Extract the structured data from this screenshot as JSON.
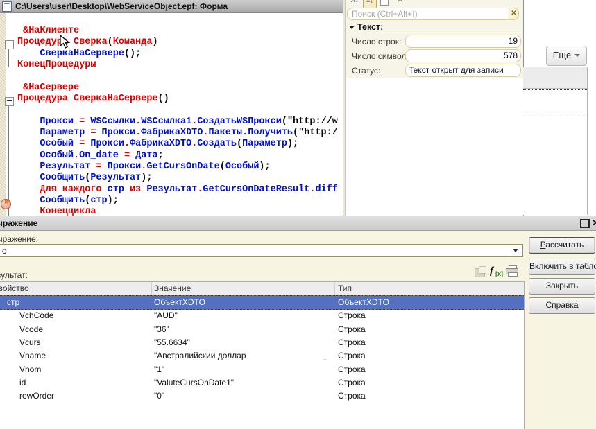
{
  "colors": {
    "keyword": "#de0000",
    "identifier": "#0010cf",
    "selection_bg": "#5470c2",
    "palette_bg": "#f7f4e8",
    "dialog_bg": "#f8f4e2"
  },
  "editor": {
    "title": "C:\\Users\\user\\Desktop\\WebServiceObject.epf: Форма",
    "code_lines": [
      [
        [
          " &НаКлиенте",
          "k"
        ]
      ],
      [
        [
          "Процедура ",
          "k"
        ],
        [
          "Сверка",
          "k"
        ],
        [
          "(",
          "d"
        ],
        [
          "Команда",
          "k"
        ],
        [
          ")",
          "d"
        ]
      ],
      [
        [
          "    ",
          "d"
        ],
        [
          "СверкаНаСервере",
          "i"
        ],
        [
          "();",
          "d"
        ]
      ],
      [
        [
          "КонецПроцедуры",
          "k"
        ]
      ],
      [],
      [
        [
          " &НаСервере",
          "k"
        ]
      ],
      [
        [
          "Процедура ",
          "k"
        ],
        [
          "СверкаНаСервере",
          "k"
        ],
        [
          "()",
          "d"
        ]
      ],
      [],
      [
        [
          "    ",
          "d"
        ],
        [
          "Прокси",
          "i"
        ],
        [
          " ",
          "d"
        ],
        [
          "=",
          "o"
        ],
        [
          " ",
          "d"
        ],
        [
          "WSСсылки",
          "i"
        ],
        [
          ".",
          "o"
        ],
        [
          "WSСсылка1",
          "i"
        ],
        [
          ".",
          "o"
        ],
        [
          "СоздатьWSПрокси",
          "i"
        ],
        [
          "(",
          "d"
        ],
        [
          "\"http://w",
          "s"
        ]
      ],
      [
        [
          "    ",
          "d"
        ],
        [
          "Параметр",
          "i"
        ],
        [
          " ",
          "d"
        ],
        [
          "=",
          "o"
        ],
        [
          " ",
          "d"
        ],
        [
          "Прокси",
          "i"
        ],
        [
          ".",
          "o"
        ],
        [
          "ФабрикаXDTO",
          "i"
        ],
        [
          ".",
          "o"
        ],
        [
          "Пакеты",
          "i"
        ],
        [
          ".",
          "o"
        ],
        [
          "Получить",
          "i"
        ],
        [
          "(",
          "d"
        ],
        [
          "\"http:/",
          "s"
        ]
      ],
      [
        [
          "    ",
          "d"
        ],
        [
          "Особый",
          "i"
        ],
        [
          " ",
          "d"
        ],
        [
          "=",
          "o"
        ],
        [
          " ",
          "d"
        ],
        [
          "Прокси",
          "i"
        ],
        [
          ".",
          "o"
        ],
        [
          "ФабрикаXDTO",
          "i"
        ],
        [
          ".",
          "o"
        ],
        [
          "Создать",
          "i"
        ],
        [
          "(",
          "d"
        ],
        [
          "Параметр",
          "i"
        ],
        [
          ");",
          "d"
        ]
      ],
      [
        [
          "    ",
          "d"
        ],
        [
          "Особый",
          "i"
        ],
        [
          ".",
          "o"
        ],
        [
          "On_date",
          "i"
        ],
        [
          " ",
          "d"
        ],
        [
          "=",
          "o"
        ],
        [
          " ",
          "d"
        ],
        [
          "Дата",
          "i"
        ],
        [
          ";",
          "d"
        ]
      ],
      [
        [
          "    ",
          "d"
        ],
        [
          "Результат",
          "i"
        ],
        [
          " ",
          "d"
        ],
        [
          "=",
          "o"
        ],
        [
          " ",
          "d"
        ],
        [
          "Прокси",
          "i"
        ],
        [
          ".",
          "o"
        ],
        [
          "GetCursOnDate",
          "i"
        ],
        [
          "(",
          "d"
        ],
        [
          "Особый",
          "i"
        ],
        [
          ");",
          "d"
        ]
      ],
      [
        [
          "    ",
          "d"
        ],
        [
          "Сообщить",
          "i"
        ],
        [
          "(",
          "d"
        ],
        [
          "Результат",
          "i"
        ],
        [
          ");",
          "d"
        ]
      ],
      [
        [
          "    ",
          "d"
        ],
        [
          "Для",
          "k"
        ],
        [
          " ",
          "d"
        ],
        [
          "каждого",
          "k"
        ],
        [
          " ",
          "d"
        ],
        [
          "стр",
          "i"
        ],
        [
          " ",
          "d"
        ],
        [
          "из",
          "k"
        ],
        [
          " ",
          "d"
        ],
        [
          "Результат",
          "i"
        ],
        [
          ".",
          "o"
        ],
        [
          "GetCursOnDateResult",
          "i"
        ],
        [
          ".",
          "o"
        ],
        [
          "diff",
          "i"
        ]
      ],
      [
        [
          "    ",
          "d"
        ],
        [
          "Сообщить",
          "i"
        ],
        [
          "(",
          "d"
        ],
        [
          "стр",
          "i"
        ],
        [
          ");",
          "d"
        ]
      ],
      [
        [
          "    ",
          "d"
        ],
        [
          "Конеццикла",
          "k"
        ]
      ]
    ]
  },
  "palette": {
    "search_placeholder": "Поиск (Ctrl+Alt+I)",
    "clear_glyph": "✕",
    "section_title": "Текст:",
    "fields": [
      {
        "label": "Число строк:",
        "value": "19"
      },
      {
        "label": "Число символов:",
        "value": "578"
      },
      {
        "label": "Статус:",
        "value": "Текст открыт для записи"
      }
    ]
  },
  "form": {
    "more_button": "Еще"
  },
  "dialog": {
    "title": "Выражение",
    "expression_label": "Выражение:",
    "expression_value": "о",
    "result_label": "Результат:",
    "truncation_mark": "_",
    "buttons": [
      {
        "name": "calculate-button",
        "pre": "",
        "key": "Р",
        "post": "ассчитать",
        "default": true
      },
      {
        "name": "include-in-watch-button",
        "pre": "Включить в ",
        "key": "т",
        "post": "абло",
        "default": false
      },
      {
        "name": "close-button",
        "pre": "",
        "key": "",
        "post": "Закрыть",
        "default": false
      },
      {
        "name": "help-button",
        "pre": "",
        "key": "",
        "post": "Справка",
        "default": false
      }
    ],
    "table": {
      "columns": [
        "Свойство",
        "Значение",
        "Тип"
      ],
      "rows": [
        {
          "prop": "стр",
          "value": "ОбъектXDTO",
          "type": "ОбъектXDTO",
          "indent": 0,
          "selected": true,
          "truncated": false
        },
        {
          "prop": "VchCode",
          "value": "\"AUD\"",
          "type": "Строка",
          "indent": 1,
          "selected": false,
          "truncated": false
        },
        {
          "prop": "Vcode",
          "value": "\"36\"",
          "type": "Строка",
          "indent": 1,
          "selected": false,
          "truncated": false
        },
        {
          "prop": "Vcurs",
          "value": "\"55.6634\"",
          "type": "Строка",
          "indent": 1,
          "selected": false,
          "truncated": false
        },
        {
          "prop": "Vname",
          "value": "\"Австралийский доллар",
          "type": "Строка",
          "indent": 1,
          "selected": false,
          "truncated": true
        },
        {
          "prop": "Vnom",
          "value": "\"1\"",
          "type": "Строка",
          "indent": 1,
          "selected": false,
          "truncated": false
        },
        {
          "prop": "id",
          "value": "\"ValuteCursOnDate1\"",
          "type": "Строка",
          "indent": 1,
          "selected": false,
          "truncated": false
        },
        {
          "prop": "rowOrder",
          "value": "\"0\"",
          "type": "Строка",
          "indent": 1,
          "selected": false,
          "truncated": false
        }
      ]
    }
  }
}
